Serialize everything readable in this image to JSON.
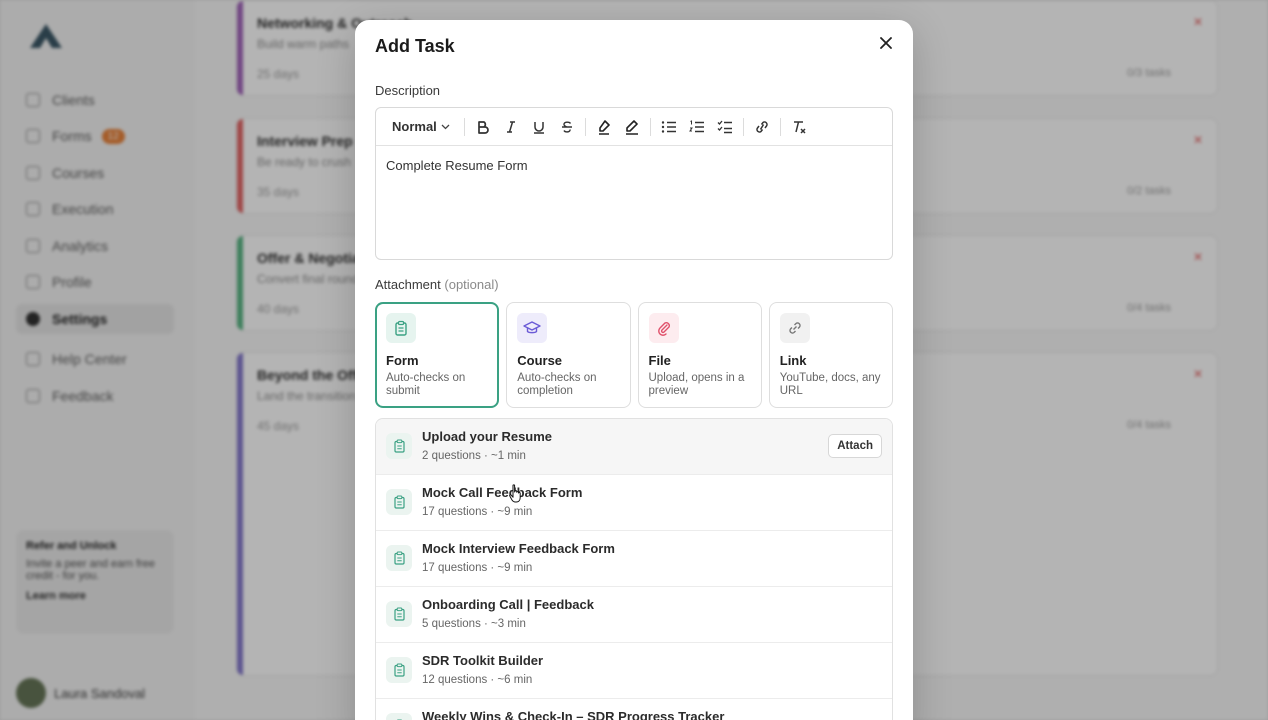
{
  "background": {
    "nav": [
      {
        "label": "Clients"
      },
      {
        "label": "Forms",
        "badge": "12"
      },
      {
        "label": "Courses"
      },
      {
        "label": "Execution"
      },
      {
        "label": "Analytics"
      },
      {
        "label": "Profile"
      },
      {
        "label": "Settings"
      },
      {
        "label": "Help Center"
      },
      {
        "label": "Feedback"
      }
    ],
    "promo": {
      "title": "Refer and Unlock",
      "body": "Invite a peer and earn free credit - for you.",
      "link": "Learn more"
    },
    "user_name": "Laura Sandoval",
    "cards": [
      {
        "title": "Networking & Outreach",
        "subtitle": "Build warm paths",
        "duration": "25 days",
        "count": "0/3 tasks",
        "color": "#9b59b6"
      },
      {
        "title": "Interview Prep",
        "subtitle": "Be ready to crush",
        "duration": "35 days",
        "count": "0/2 tasks",
        "color": "#e05a5a"
      },
      {
        "title": "Offer & Negotiation",
        "subtitle": "Convert final rounds",
        "duration": "40 days",
        "count": "0/4 tasks",
        "color": "#4caf7a"
      },
      {
        "title": "Beyond the Offer",
        "subtitle": "Land the transition",
        "duration": "45 days",
        "count": "0/4 tasks",
        "color": "#7b6fc9"
      }
    ]
  },
  "modal": {
    "title": "Add Task",
    "description_label": "Description",
    "format_select": "Normal",
    "description_text": "Complete Resume Form",
    "attachment_label": "Attachment",
    "attachment_optional": "(optional)",
    "attachment_types": [
      {
        "name": "Form",
        "desc": "Auto-checks on submit",
        "icon": "clipboard-icon",
        "color": "#3aa183",
        "bg": "#e6f4ef"
      },
      {
        "name": "Course",
        "desc": "Auto-checks on completion",
        "icon": "graduation-cap-icon",
        "color": "#6b5bd6",
        "bg": "#eeecfb"
      },
      {
        "name": "File",
        "desc": "Upload, opens in a preview",
        "icon": "paperclip-icon",
        "color": "#e0506a",
        "bg": "#fdecef"
      },
      {
        "name": "Link",
        "desc": "YouTube, docs, any URL",
        "icon": "link-icon",
        "color": "#777777",
        "bg": "#f1f1f1"
      }
    ],
    "forms": [
      {
        "name": "Upload your Resume",
        "meta": "2 questions · ~1 min"
      },
      {
        "name": "Mock Call Feedback Form",
        "meta": "17 questions · ~9 min"
      },
      {
        "name": "Mock Interview Feedback Form",
        "meta": "17 questions · ~9 min"
      },
      {
        "name": "Onboarding Call | Feedback",
        "meta": "5 questions · ~3 min"
      },
      {
        "name": "SDR Toolkit Builder",
        "meta": "12 questions · ~6 min"
      },
      {
        "name": "Weekly Wins & Check-In – SDR Progress Tracker",
        "meta": ""
      }
    ],
    "attach_label": "Attach"
  }
}
